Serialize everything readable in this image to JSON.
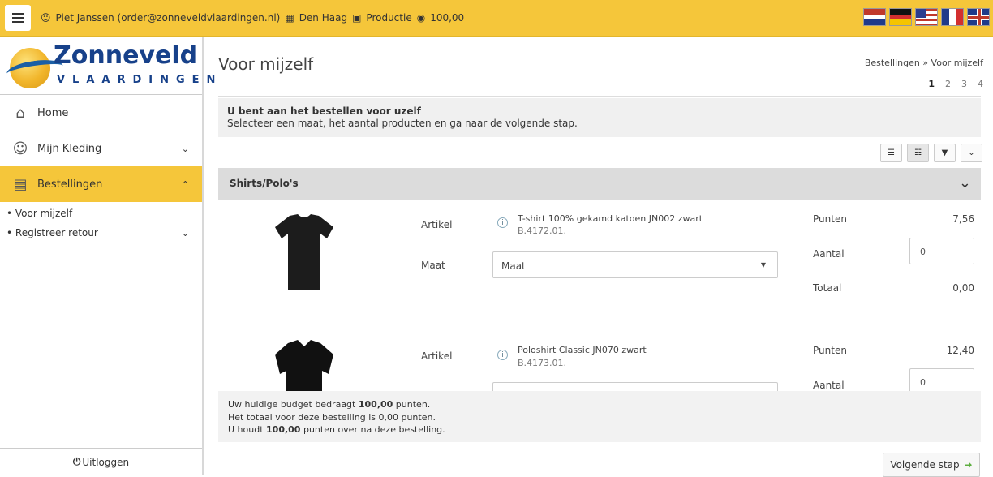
{
  "topbar": {
    "user": "Piet Janssen (order@zonneveldvlaardingen.nl)",
    "location": "Den Haag",
    "department": "Productie",
    "budget": "100,00",
    "flags": [
      "nl-flag",
      "de-flag",
      "us-flag",
      "fr-flag",
      "gb-flag"
    ]
  },
  "logo": {
    "name": "Zonneveld",
    "sub": "VLAARDINGEN"
  },
  "sidebar": {
    "items": [
      {
        "label": "Home",
        "icon": "home-icon"
      },
      {
        "label": "Mijn Kleding",
        "icon": "user-icon"
      },
      {
        "label": "Bestellingen",
        "icon": "document-icon"
      }
    ],
    "subitems": [
      "• Voor mijzelf",
      "• Registreer retour"
    ],
    "logout": "Uitloggen"
  },
  "page": {
    "title": "Voor mijzelf",
    "breadcrumb": "Bestellingen » Voor mijzelf",
    "steps": [
      "1",
      "2",
      "3",
      "4"
    ],
    "notice_title": "U bent aan het bestellen voor uzelf",
    "notice_text": "Selecteer een maat, het aantal producten en ga naar de volgende stap.",
    "section": "Shirts/Polo's"
  },
  "labels": {
    "artikel": "Artikel",
    "maat": "Maat",
    "punten": "Punten",
    "aantal": "Aantal",
    "totaal": "Totaal"
  },
  "products": [
    {
      "name": "T-shirt 100% gekamd katoen JN002 zwart",
      "code": "B.4172.01.",
      "size": "Maat",
      "points": "7,56",
      "quantity": "0",
      "total": "0,00"
    },
    {
      "name": "Poloshirt Classic JN070 zwart",
      "code": "B.4173.01.",
      "points": "12,40",
      "quantity": "0"
    }
  ],
  "budget": {
    "line1_pre": "Uw huidige budget bedraagt ",
    "line1_val": "100,00",
    "line1_post": " punten.",
    "line2": "Het totaal voor deze bestelling is 0,00 punten.",
    "line3_pre": "U houdt ",
    "line3_val": "100,00",
    "line3_post": " punten over na deze bestelling."
  },
  "next_button": "Volgende stap",
  "colors": {
    "accent": "#f5c63a",
    "brand": "#17418a"
  }
}
